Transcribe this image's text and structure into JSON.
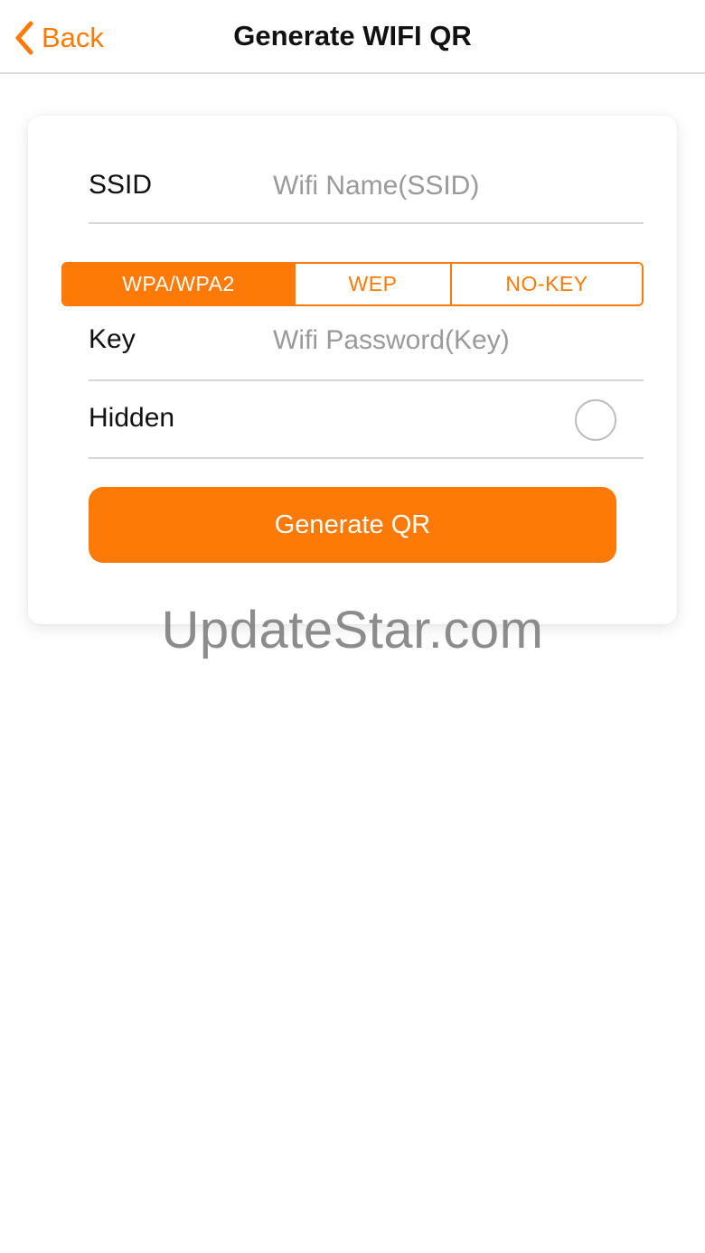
{
  "nav": {
    "back_label": "Back",
    "title": "Generate WIFI QR"
  },
  "form": {
    "ssid_label": "SSID",
    "ssid_placeholder": "Wifi Name(SSID)",
    "ssid_value": "",
    "security_options": [
      "WPA/WPA2",
      "WEP",
      "NO-KEY"
    ],
    "security_selected": "WPA/WPA2",
    "key_label": "Key",
    "key_placeholder": "Wifi Password(Key)",
    "key_value": "",
    "hidden_label": "Hidden",
    "hidden_checked": false,
    "generate_label": "Generate QR"
  },
  "watermark": "UpdateStar.com",
  "colors": {
    "accent": "#fe7a06",
    "placeholder": "#9a9a9a",
    "divider": "#d6d6d6"
  },
  "icons": {
    "back": "chevron-left-icon",
    "hidden_toggle": "radio-circle-icon"
  }
}
